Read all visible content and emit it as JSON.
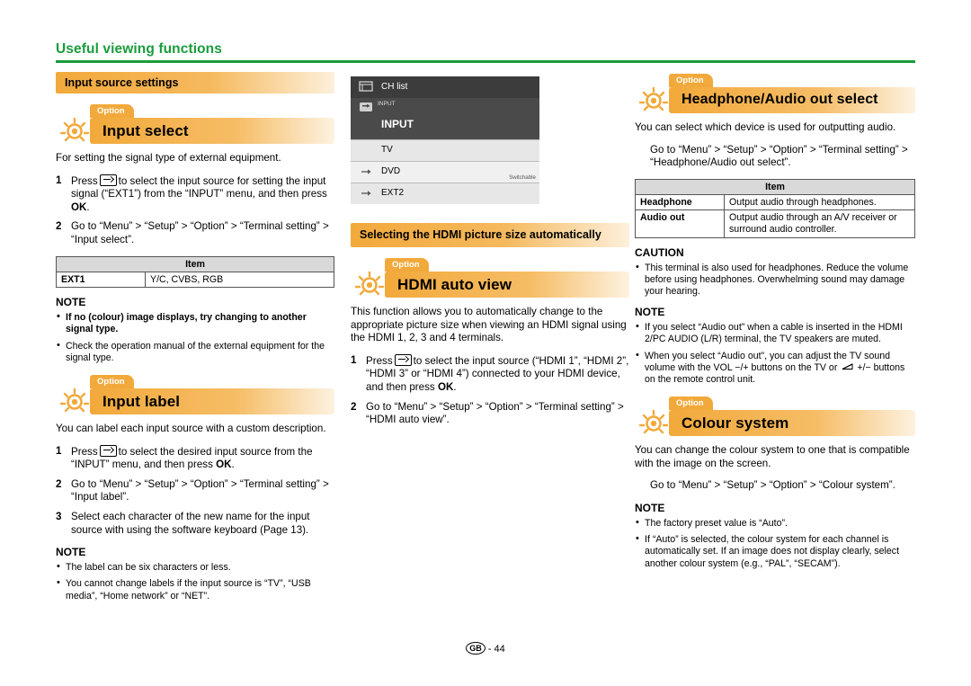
{
  "header": {
    "title": "Useful viewing functions"
  },
  "footer": {
    "mark": "GB",
    "separator": "-",
    "page": "44"
  },
  "col1": {
    "section_title": "Input source settings",
    "input_select": {
      "option_tab": "Option",
      "title": "Input select",
      "intro": "For setting the signal type of external equipment.",
      "steps": [
        {
          "n": "1",
          "text_before": "Press",
          "text_after": "to select the input source for setting the input signal (“EXT1”) from the “INPUT” menu, and then press",
          "bold_end": "OK",
          "tail": "."
        },
        {
          "n": "2",
          "text": "Go to “Menu” > “Setup” > “Option” > “Terminal setting” > “Input select”."
        }
      ],
      "table": {
        "header": "Item",
        "rows": [
          {
            "key": "EXT1",
            "value": "Y/C, CVBS, RGB"
          }
        ]
      },
      "note_title": "NOTE",
      "notes": [
        {
          "text": "If no (colour) image displays, try changing to another signal type.",
          "bold": true
        },
        {
          "text": "Check the operation manual of the external equipment for the signal type.",
          "bold": false
        }
      ]
    },
    "input_label": {
      "option_tab": "Option",
      "title": "Input label",
      "intro": "You can label each input source with a custom description.",
      "steps": [
        {
          "n": "1",
          "text_before": "Press",
          "text_after": "to select the desired input source from the “INPUT” menu, and then press",
          "bold_end": "OK",
          "tail": "."
        },
        {
          "n": "2",
          "text": "Go to “Menu” > “Setup” > “Option” > “Terminal setting” > “Input label”."
        },
        {
          "n": "3",
          "text": "Select each character of the new name for the input source with using the software keyboard (Page 13)."
        }
      ],
      "note_title": "NOTE",
      "notes": [
        {
          "text": "The label can be six characters or less.",
          "bold": false
        },
        {
          "text": "You cannot change labels if the input source is “TV”, “USB media”, “Home network” or “NET”.",
          "bold": false
        }
      ]
    }
  },
  "col2": {
    "osd": {
      "ch_list": "CH list",
      "input_tab": "INPUT",
      "input_title": "INPUT",
      "rows": [
        {
          "label": "TV",
          "sub": ""
        },
        {
          "label": "DVD",
          "sub": "Switchable"
        },
        {
          "label": "EXT2",
          "sub": ""
        }
      ]
    },
    "section_title": "Selecting the HDMI picture size automatically",
    "hdmi_auto_view": {
      "option_tab": "Option",
      "title": "HDMI auto view",
      "intro": "This function allows you to automatically change to the appropriate picture size when viewing an HDMI signal using the HDMI 1, 2, 3 and 4 terminals.",
      "steps": [
        {
          "n": "1",
          "text_before": "Press",
          "text_after": "to select the input source (“HDMI 1”, “HDMI 2”, “HDMI 3” or “HDMI 4”) connected to your HDMI device, and then press",
          "bold_end": "OK",
          "tail": "."
        },
        {
          "n": "2",
          "text": "Go to “Menu” > “Setup” > “Option” > “Terminal setting” > “HDMI auto view”."
        }
      ]
    }
  },
  "col3": {
    "headphone": {
      "option_tab": "Option",
      "title": "Headphone/Audio out select",
      "intro": "You can select which device is used for outputting audio.",
      "step": "Go to “Menu” > “Setup” > “Option” > “Terminal setting” > “Headphone/Audio out select”.",
      "table": {
        "header": "Item",
        "rows": [
          {
            "key": "Headphone",
            "value": "Output audio through headphones."
          },
          {
            "key": "Audio out",
            "value": "Output audio through an A/V receiver or surround audio controller."
          }
        ]
      },
      "caution_title": "CAUTION",
      "cautions": [
        {
          "text": "This terminal is also used for headphones. Reduce the volume before using headphones. Overwhelming sound may damage your hearing."
        }
      ],
      "note_title": "NOTE",
      "notes": [
        {
          "text": "If you select “Audio out” when a cable is inserted in the HDMI 2/PC AUDIO (L/R) terminal, the TV speakers are muted."
        },
        {
          "text_before": "When you select “Audio out”, you can adjust the TV sound volume with the VOL −/+ buttons on the TV or",
          "text_after": "+/− buttons on the remote control unit."
        }
      ]
    },
    "colour_system": {
      "option_tab": "Option",
      "title": "Colour system",
      "intro": "You can change the colour system to one that is compatible with the image on the screen.",
      "step": "Go to “Menu” > “Setup” > “Option” > “Colour system”.",
      "note_title": "NOTE",
      "notes": [
        {
          "text": "The factory preset value is “Auto”."
        },
        {
          "text": "If “Auto” is selected, the colour system for each channel is automatically set. If an image does not display clearly, select another colour system (e.g., “PAL”, “SECAM”)."
        }
      ]
    }
  },
  "colors": {
    "green": "#1a9c3c",
    "orange": "#f2a93b"
  }
}
